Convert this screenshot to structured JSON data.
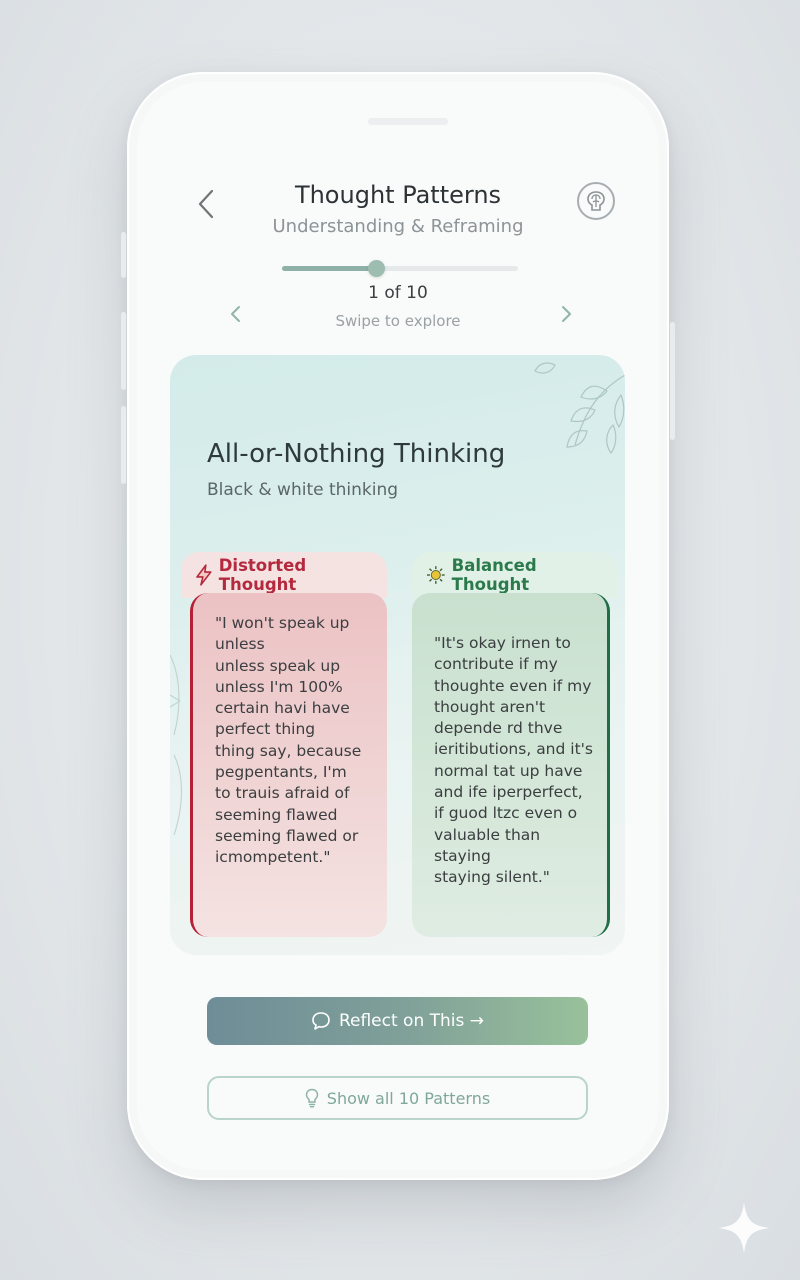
{
  "header": {
    "title": "Thought Patterns",
    "subtitle": "Understanding & Reframing",
    "back_icon": "chevron-left-icon",
    "brain_icon": "brain-icon"
  },
  "pager": {
    "counter": "1 of 10",
    "hint": "Swipe to explore",
    "progress": 0.4
  },
  "card": {
    "title": "All-or-Nothing Thinking",
    "subtitle": "Black & white thinking",
    "distorted": {
      "icon": "lightning-icon",
      "label": "Distorted Thought",
      "text": "\"I won't speak up\nunless\nunless speak up\nunless I'm 100%\ncertain havi have\nperfect thing\nthing say, because\npegpentants, I'm\nto trauis afraid of\nseeming flawed\nseeming flawed or\nicmompetent.\""
    },
    "balanced": {
      "icon": "sun-icon",
      "label": "Balanced Thought",
      "text": "\"It's okay irnen to\ncontribute if my\nthoughte even if my\nthought aren't\ndepende rd thve\nieritibutions, and it's\nnormal tat up have\nand ife iperperfect,\nif guod ltzc even o\nvaluable than staying\nstaying silent.\""
    }
  },
  "actions": {
    "reflect_label": "Reflect on This →",
    "show_all_label": "Show all 10 Patterns"
  },
  "colors": {
    "accent_teal": "#8fb0a6",
    "distorted_red": "#b4293d",
    "balanced_green": "#2b7a4b"
  }
}
